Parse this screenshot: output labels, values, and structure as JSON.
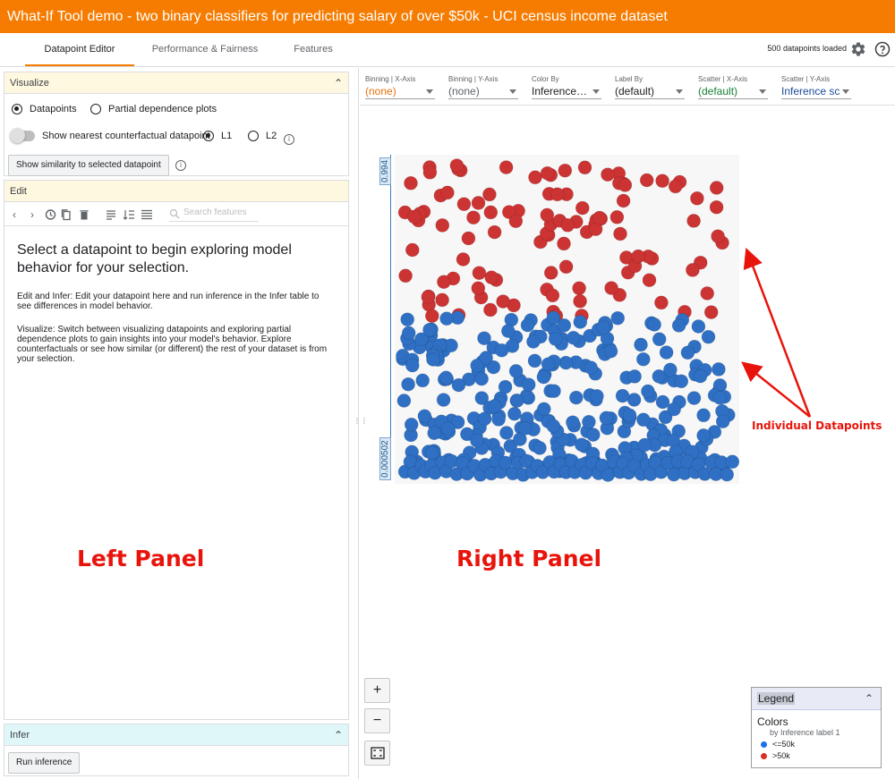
{
  "window": {
    "title": "What-If Tool demo - two binary classifiers for predicting salary of over $50k - UCI census income dataset"
  },
  "tabs": [
    {
      "label": "Datapoint Editor",
      "active": true
    },
    {
      "label": "Performance & Fairness",
      "active": false
    },
    {
      "label": "Features",
      "active": false
    }
  ],
  "status": {
    "loaded": "500 datapoints loaded"
  },
  "visualize": {
    "header": "Visualize",
    "radio_datapoints": "Datapoints",
    "radio_pdp": "Partial dependence plots",
    "counterfactual_label": "Show nearest counterfactual datapoint",
    "l1": "L1",
    "l2": "L2",
    "similarity_button": "Show similarity to selected datapoint"
  },
  "edit": {
    "header": "Edit",
    "search_placeholder": "Search features",
    "big_message": "Select a datapoint to begin exploring model behavior for your selection.",
    "para1": "Edit and Infer: Edit your datapoint here and run inference in the Infer table to see differences in model behavior.",
    "para2": "Visualize: Switch between visualizing datapoints and exploring partial dependence plots to gain insights into your model's behavior. Explore counterfactuals or see how similar (or different) the rest of your dataset is from your selection."
  },
  "infer": {
    "header": "Infer",
    "run_button": "Run inference"
  },
  "controls": [
    {
      "label": "Binning | X-Axis",
      "value": "(none)",
      "color": "#e8710a"
    },
    {
      "label": "Binning | Y-Axis",
      "value": "(none)",
      "color": "#5f6368"
    },
    {
      "label": "Color By",
      "value": "Inference…",
      "color": "#202124"
    },
    {
      "label": "Label By",
      "value": "(default)",
      "color": "#202124"
    },
    {
      "label": "Scatter | X-Axis",
      "value": "(default)",
      "color": "#188038"
    },
    {
      "label": "Scatter | Y-Axis",
      "value": "Inference sc",
      "color": "#1a4c99"
    }
  ],
  "plot": {
    "y_top": "0.994",
    "y_bottom": "0.000502",
    "colors": {
      "high": "#cc3333",
      "low": "#2f70c4"
    }
  },
  "legend": {
    "header": "Legend",
    "colors_label": "Colors",
    "by_label": "by Inference label 1",
    "items": [
      {
        "label": "<=50k",
        "color": "#1a73e8"
      },
      {
        "label": ">50k",
        "color": "#d93025"
      }
    ]
  },
  "annotations": {
    "left": "Left Panel",
    "right": "Right Panel",
    "datapoints": "Individual Datapoints"
  }
}
